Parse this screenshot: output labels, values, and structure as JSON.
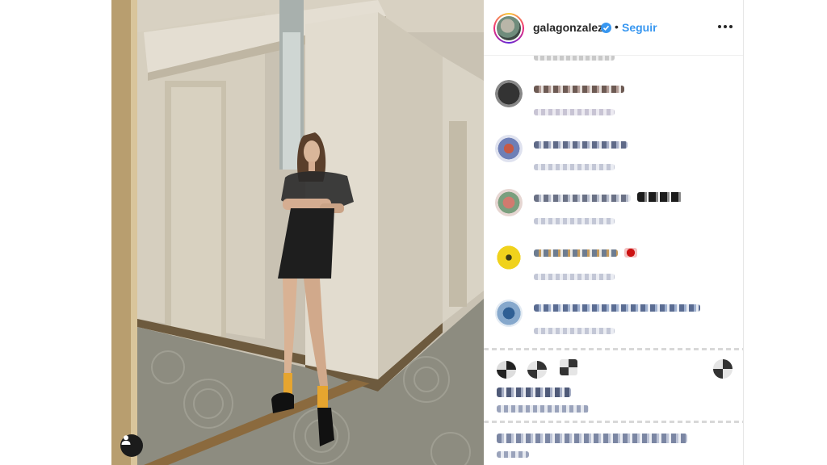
{
  "post": {
    "username": "galagonzalez",
    "verified": true,
    "separator": "•",
    "follow_label": "Seguir",
    "more_options_icon": "ellipsis-icon",
    "user_tag_icon": "person-icon"
  },
  "comments": {
    "top_partial_meta": "6 sem  Responder",
    "censored": true
  },
  "colors": {
    "accent": "#3897f0",
    "text": "#262626",
    "divider": "#efefef"
  }
}
